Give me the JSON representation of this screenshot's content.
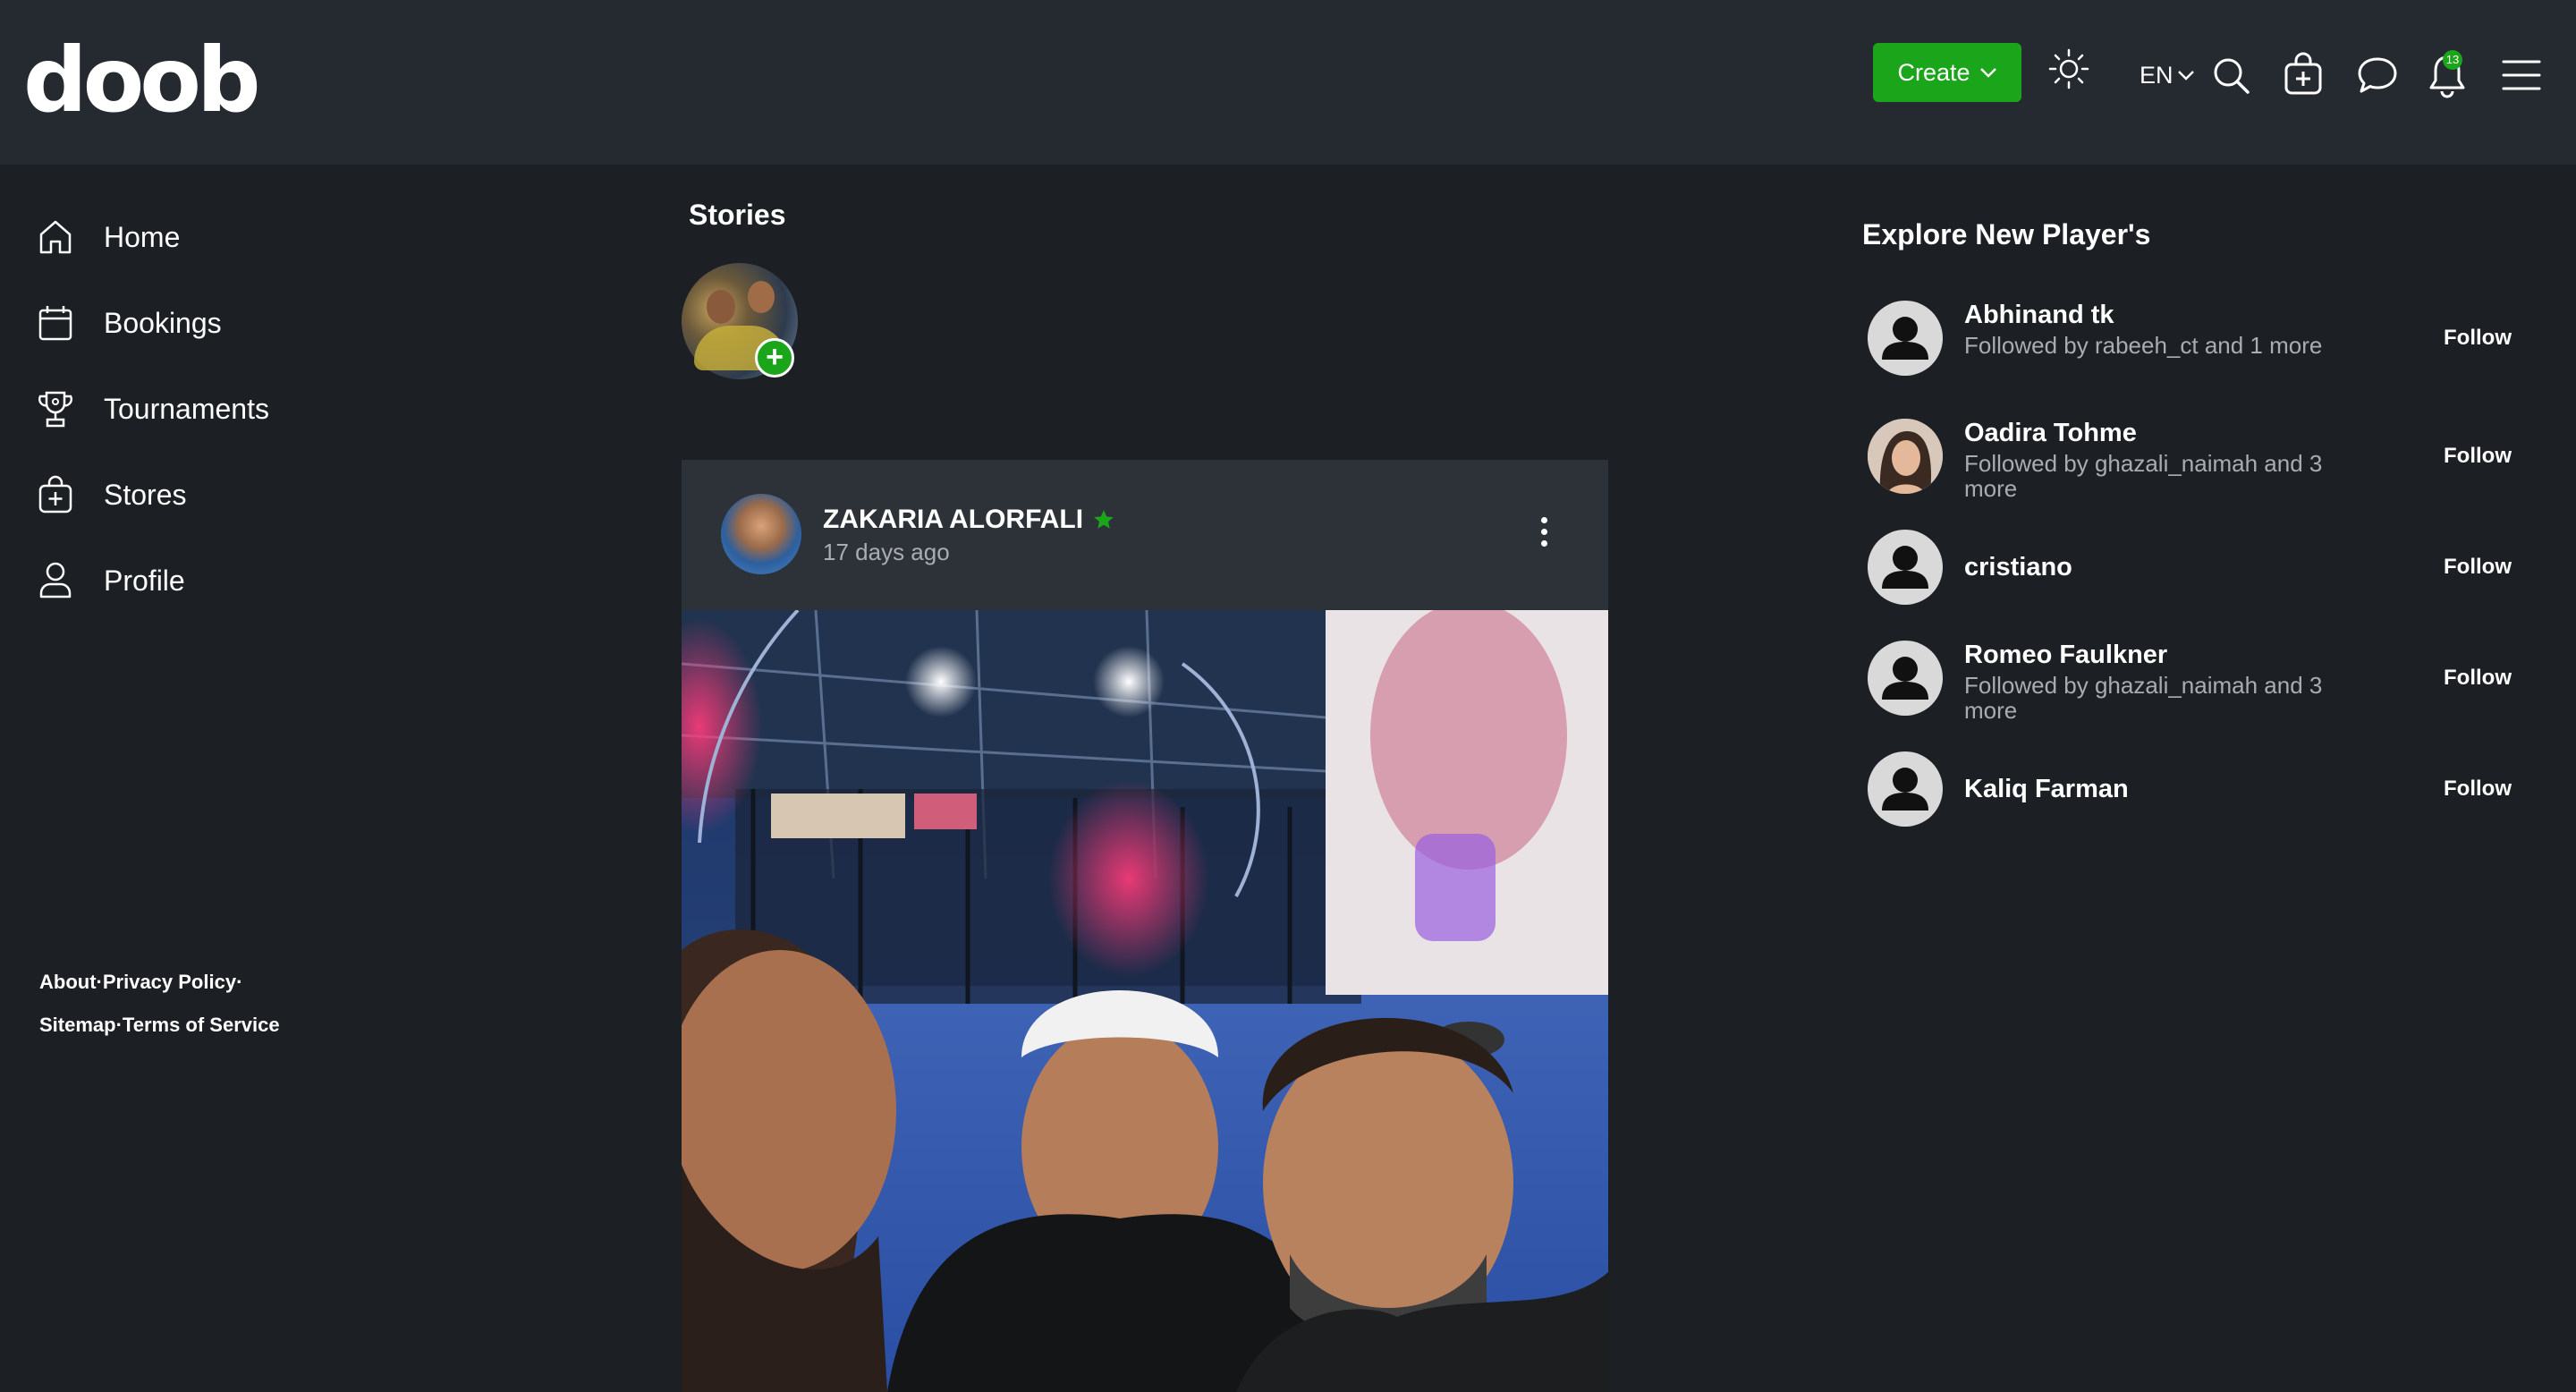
{
  "header": {
    "logo": "doob",
    "create_label": "Create",
    "language": "EN",
    "notification_count": "13"
  },
  "sidebar": {
    "items": [
      {
        "label": "Home",
        "icon": "home-icon"
      },
      {
        "label": "Bookings",
        "icon": "calendar-icon"
      },
      {
        "label": "Tournaments",
        "icon": "trophy-icon"
      },
      {
        "label": "Stores",
        "icon": "store-bag-icon"
      },
      {
        "label": "Profile",
        "icon": "user-icon"
      }
    ],
    "footer": {
      "about": "About",
      "privacy": "Privacy Policy",
      "sitemap": "Sitemap",
      "terms": "Terms of Service",
      "separator": "·"
    }
  },
  "stories": {
    "title": "Stories",
    "add_symbol": "+"
  },
  "post": {
    "author": "ZAKARIA ALORFALI",
    "time": "17 days ago",
    "verified_icon": "star-badge-icon"
  },
  "explore": {
    "title": "Explore New Player's",
    "follow_label": "Follow",
    "players": [
      {
        "name": "Abhinand tk",
        "subtitle": "Followed by rabeeh_ct and 1 more",
        "avatar": "default"
      },
      {
        "name": "Oadira Tohme",
        "subtitle": "Followed by ghazali_naimah and 3 more",
        "avatar": "photo"
      },
      {
        "name": "cristiano",
        "subtitle": "",
        "avatar": "default"
      },
      {
        "name": "Romeo Faulkner",
        "subtitle": "Followed by ghazali_naimah and 3 more",
        "avatar": "default"
      },
      {
        "name": "Kaliq Farman",
        "subtitle": "",
        "avatar": "default"
      }
    ]
  },
  "colors": {
    "background": "#1c2024",
    "topbar": "#252a30",
    "card": "#2d3238",
    "accent_green": "#1aa51a",
    "muted_text": "#a9adb2"
  }
}
